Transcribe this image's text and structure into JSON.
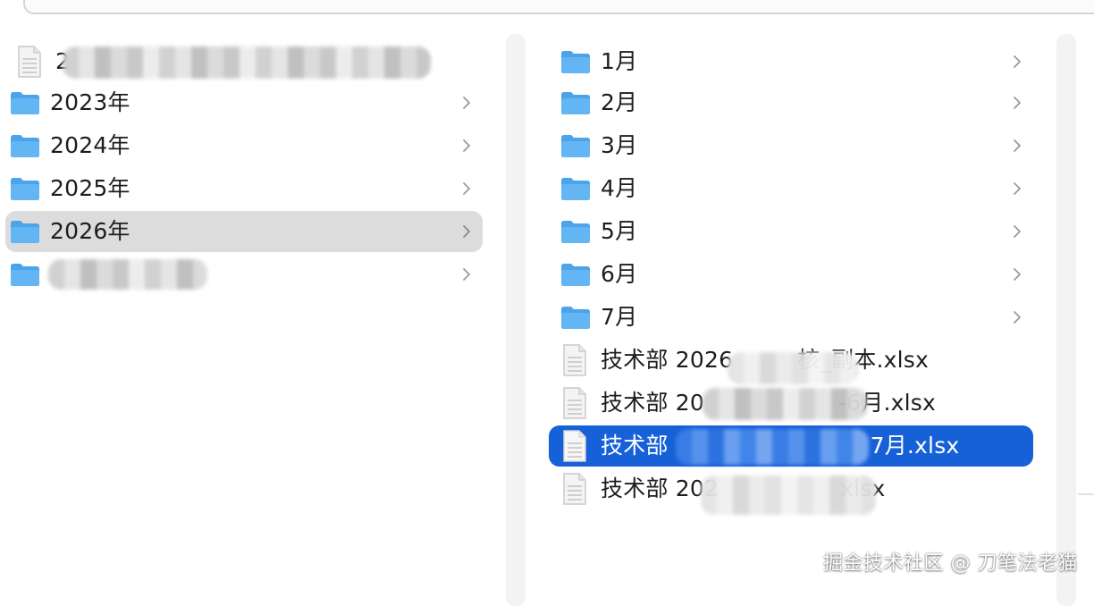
{
  "left_column": {
    "items": [
      {
        "type": "file",
        "label": "2",
        "has_chevron": false,
        "selected": false
      },
      {
        "type": "folder",
        "label": "2023年",
        "has_chevron": true,
        "selected": false
      },
      {
        "type": "folder",
        "label": "2024年",
        "has_chevron": true,
        "selected": false
      },
      {
        "type": "folder",
        "label": "2025年",
        "has_chevron": true,
        "selected": false
      },
      {
        "type": "folder",
        "label": "2026年",
        "has_chevron": true,
        "selected": true
      },
      {
        "type": "folder",
        "label": "",
        "has_chevron": true,
        "selected": false
      }
    ]
  },
  "right_column": {
    "items": [
      {
        "type": "folder",
        "label": "1月",
        "has_chevron": true
      },
      {
        "type": "folder",
        "label": "2月",
        "has_chevron": true
      },
      {
        "type": "folder",
        "label": "3月",
        "has_chevron": true
      },
      {
        "type": "folder",
        "label": "4月",
        "has_chevron": true
      },
      {
        "type": "folder",
        "label": "5月",
        "has_chevron": true
      },
      {
        "type": "folder",
        "label": "6月",
        "has_chevron": true
      },
      {
        "type": "folder",
        "label": "7月",
        "has_chevron": true
      },
      {
        "type": "file",
        "label": "技术部 2026 年 绩 效 考 核_副本.xlsx",
        "label_visible_start": "技术部 2026",
        "label_visible_end": "核_副本.xlsx",
        "has_chevron": false
      },
      {
        "type": "file",
        "label_visible_start": "技术部 20",
        "label_visible_end": "-6月.xlsx",
        "has_chevron": false
      },
      {
        "type": "file",
        "label_visible_start": "技术部",
        "label_visible_end": "7月.xlsx",
        "has_chevron": false,
        "selected": true
      },
      {
        "type": "file",
        "label_visible_start": "技术部 202",
        "label_visible_end": "xlsx",
        "has_chevron": false
      }
    ]
  },
  "watermark": "掘金技术社区 @ 刀笔法老猫",
  "colors": {
    "folder_blue": "#5aaef0",
    "selection_blue": "#1660d8",
    "selection_gray": "#dcdcdc"
  },
  "icons": {
    "folder": "folder-icon",
    "file": "spreadsheet-file-icon",
    "chevron": "chevron-right-icon"
  }
}
